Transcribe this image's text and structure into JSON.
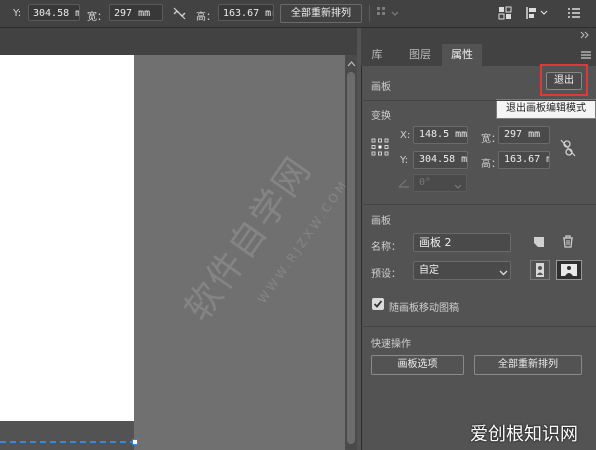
{
  "toolbar": {
    "y_label": "Y:",
    "y_value": "304.58 mr",
    "w_label": "宽：",
    "w_value": "297 mm",
    "h_label": "高：",
    "h_value": "163.67 mr",
    "rearrange_all_label": "全部重新排列"
  },
  "panel": {
    "tabs": [
      {
        "label": "库"
      },
      {
        "label": "图层"
      },
      {
        "label": "属性"
      }
    ],
    "artboard_section_title": "画板",
    "exit_label": "退出",
    "tooltip": "退出画板编辑模式",
    "transform": {
      "title": "变换",
      "x_label": "X:",
      "x_value": "148.5 mm",
      "y_label": "Y:",
      "y_value": "304.58 m",
      "w_label": "宽：",
      "w_value": "297 mm",
      "h_label": "高：",
      "h_value": "163.67 m",
      "angle_value": "0°"
    },
    "artboard": {
      "title": "画板",
      "name_label": "名称：",
      "name_value": "画板 2",
      "preset_label": "预设：",
      "preset_value": "自定",
      "move_with_artboard_label": "随画板移动图稿",
      "move_with_artboard_checked": true
    },
    "quick_actions": {
      "title": "快速操作",
      "artboard_options_label": "画板选项",
      "rearrange_all_label": "全部重新排列"
    }
  },
  "watermark": {
    "text": "软件自学网",
    "sub": "WWW.RJZXW.COM"
  },
  "site_mark": "爱创根知识网",
  "colors": {
    "highlight": "#e0393c",
    "selection": "#3a87d6"
  }
}
